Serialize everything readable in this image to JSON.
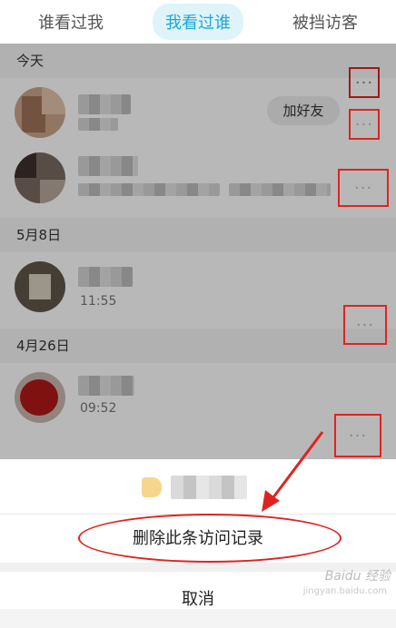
{
  "tabs": [
    {
      "label": "谁看过我",
      "active": false
    },
    {
      "label": "我看过谁",
      "active": true
    },
    {
      "label": "被挡访客",
      "active": false
    }
  ],
  "sections": [
    {
      "date": "今天"
    },
    {
      "date": "5月8日"
    },
    {
      "date": "4月26日"
    }
  ],
  "rows": [
    {
      "time": "",
      "action": "加好友"
    },
    {
      "time": ""
    },
    {
      "time": "11:55"
    },
    {
      "time": "09:52"
    }
  ],
  "more_glyph": "···",
  "sheet": {
    "delete_label": "删除此条访问记录",
    "cancel_label": "取消"
  },
  "watermark": {
    "text": "Baidu 经验",
    "sub": "jingyan.baidu.com"
  },
  "colors": {
    "accent": "#1aa9d6",
    "annotation_red": "#e0231f"
  }
}
